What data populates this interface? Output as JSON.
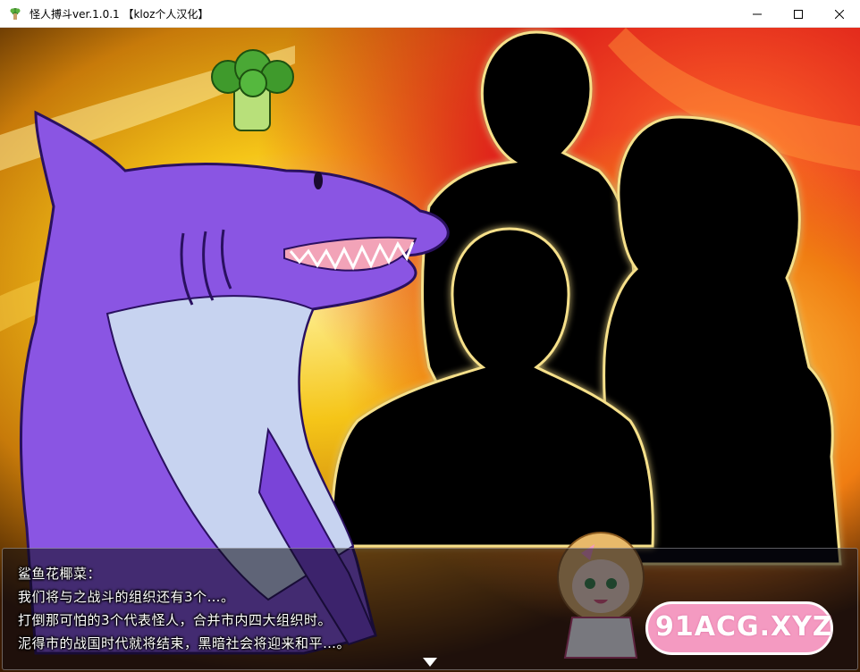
{
  "window": {
    "title": "怪人搏斗ver.1.0.1 【kloz个人汉化】",
    "icon": "game-app-icon",
    "controls": [
      "minimize-icon",
      "maximize-icon",
      "close-icon"
    ]
  },
  "dialogue": {
    "speaker": "鲨鱼花椰菜：",
    "lines": [
      "我们将与之战斗的组织还有3个…。",
      "打倒那可怕的3个代表怪人，合并市内四大组织时。",
      "泥得市的战国时代就将结束，黑暗社会将迎来和平…。"
    ],
    "continue_indicator": "down-triangle-icon"
  },
  "watermark": {
    "text": "91ACG.XYZ"
  },
  "colors": {
    "shark_body": "#8a55e3",
    "shark_belly": "#c7d3f0",
    "fire_yellow": "#f5c518",
    "fire_red": "#e0241b",
    "watermark_pink": "#f49ac1"
  }
}
